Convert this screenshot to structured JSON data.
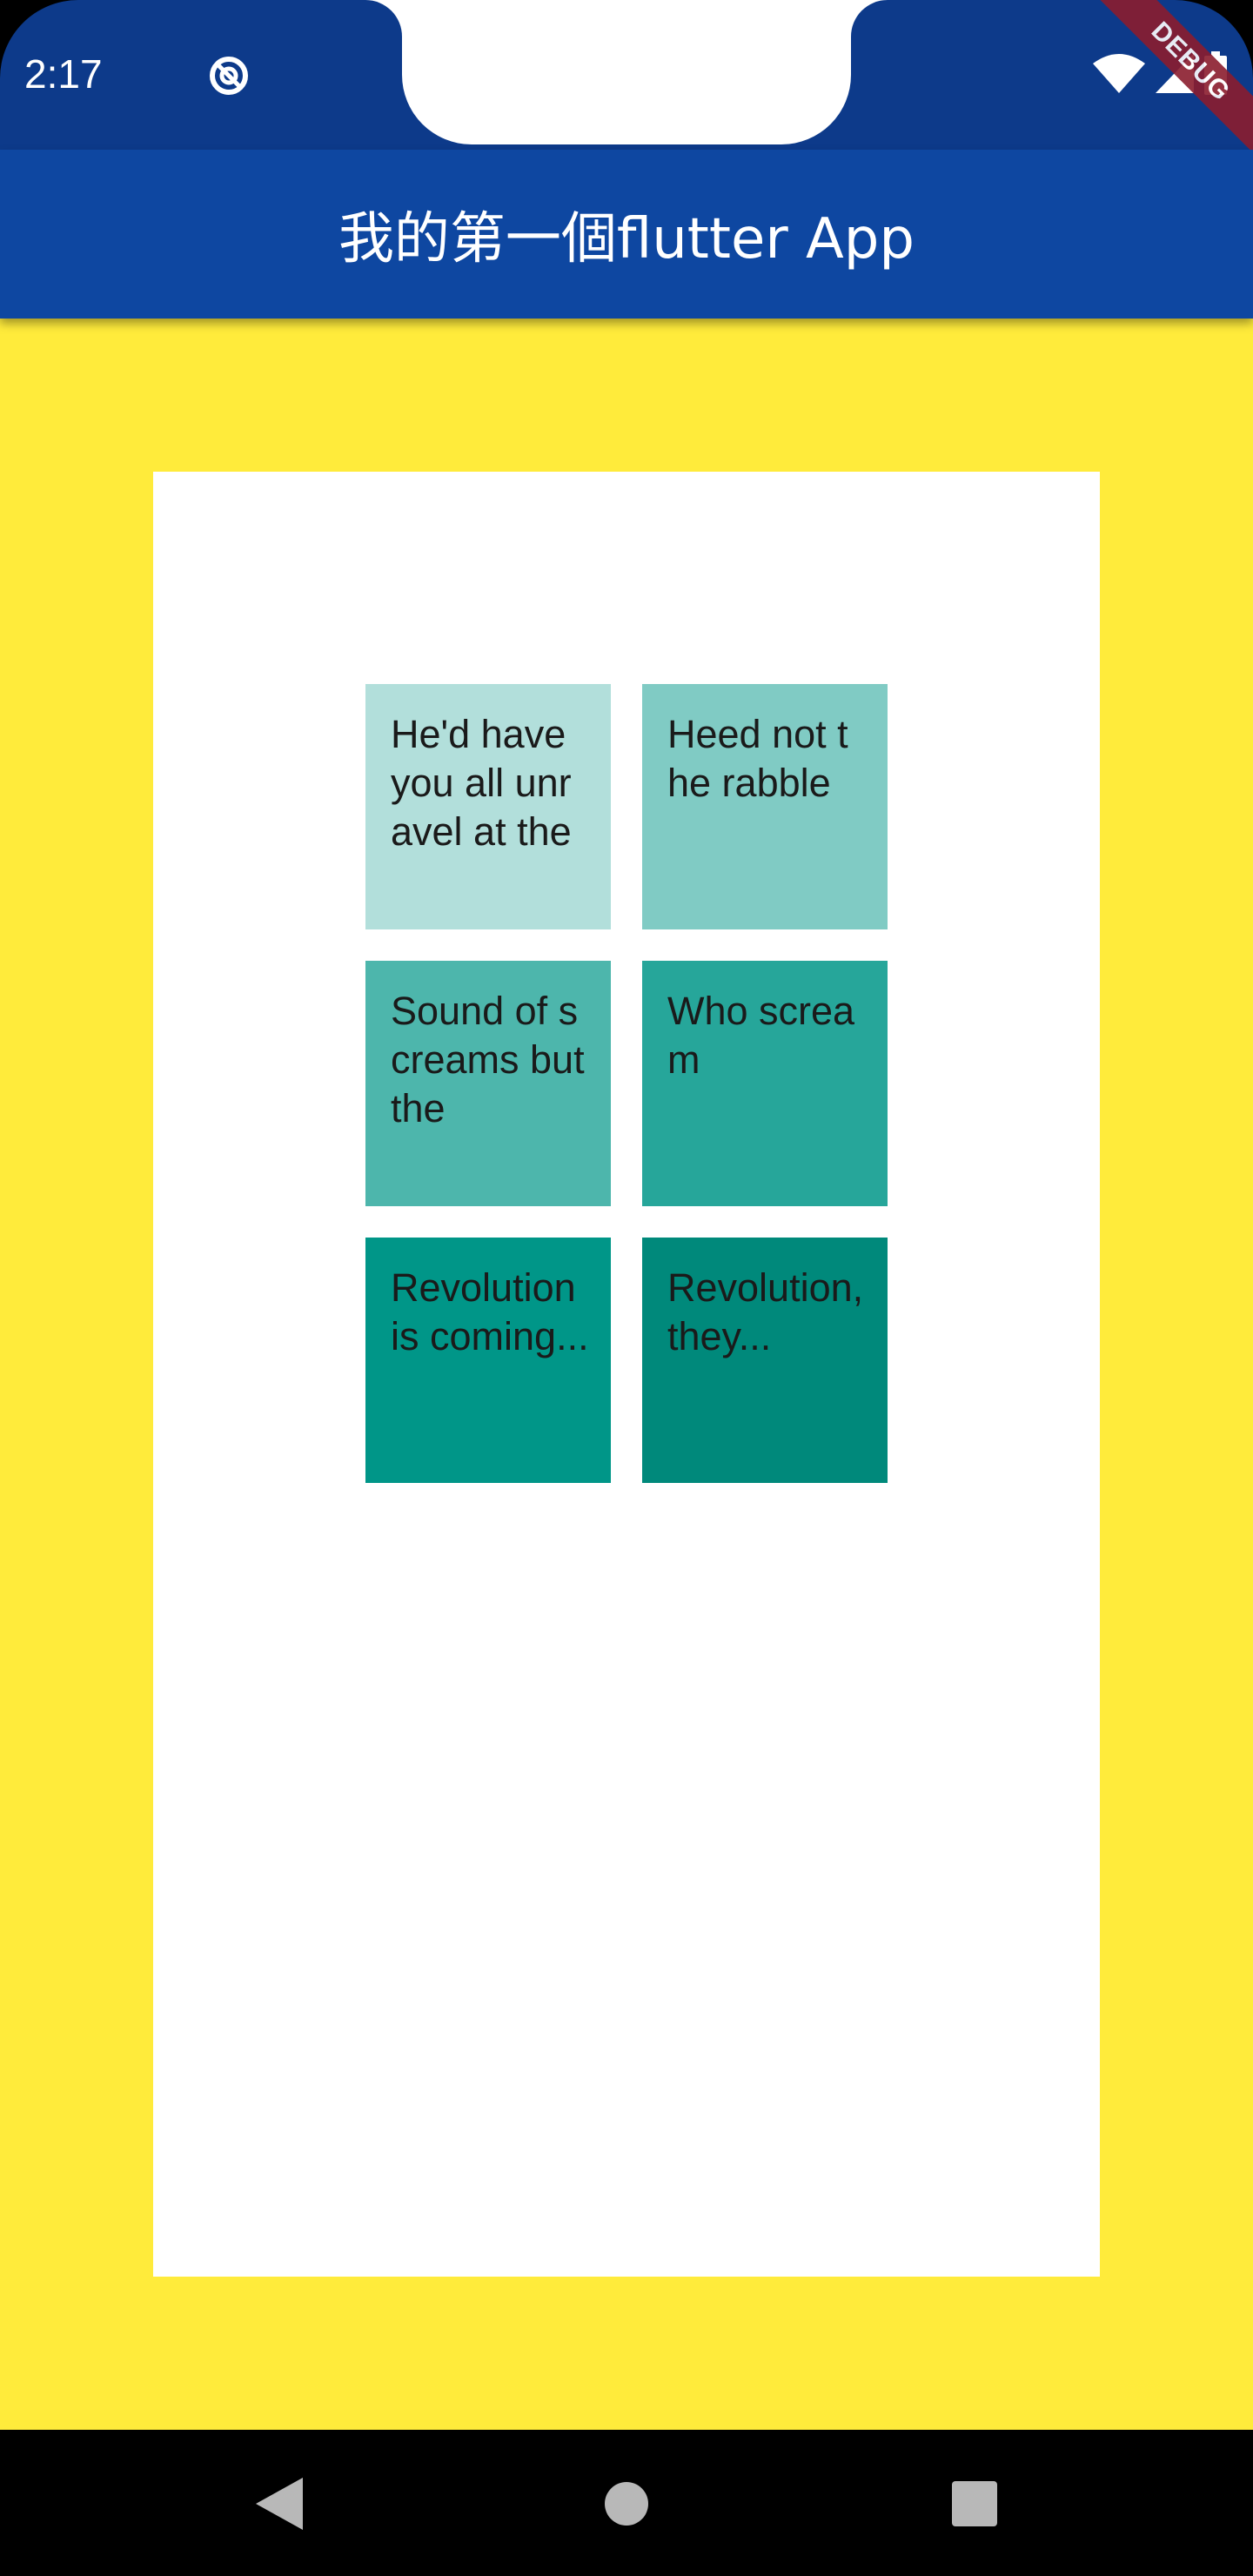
{
  "status_bar": {
    "time": "2:17",
    "debug_label": "DEBUG",
    "icons": [
      "do-not-disturb-icon",
      "wifi-icon",
      "signal-icon",
      "battery-icon"
    ]
  },
  "app_bar": {
    "title": "我的第一個flutter App"
  },
  "colors": {
    "status_bar": "#0d3a8a",
    "app_bar": "#0e47a1",
    "background": "#ffeb3b",
    "panel": "#ffffff",
    "tiles": [
      "#b2dfdb",
      "#80cbc4",
      "#4db6ac",
      "#26a69a",
      "#009688",
      "#00897b"
    ]
  },
  "grid": {
    "tiles": [
      {
        "text": "He'd have you all unravel at the"
      },
      {
        "text": "Heed not the rabble"
      },
      {
        "text": "Sound of screams but the"
      },
      {
        "text": "Who scream"
      },
      {
        "text": "Revolution is coming..."
      },
      {
        "text": "Revolution, they..."
      }
    ]
  },
  "nav_bar": {
    "buttons": [
      "back-icon",
      "home-icon",
      "recents-icon"
    ]
  }
}
